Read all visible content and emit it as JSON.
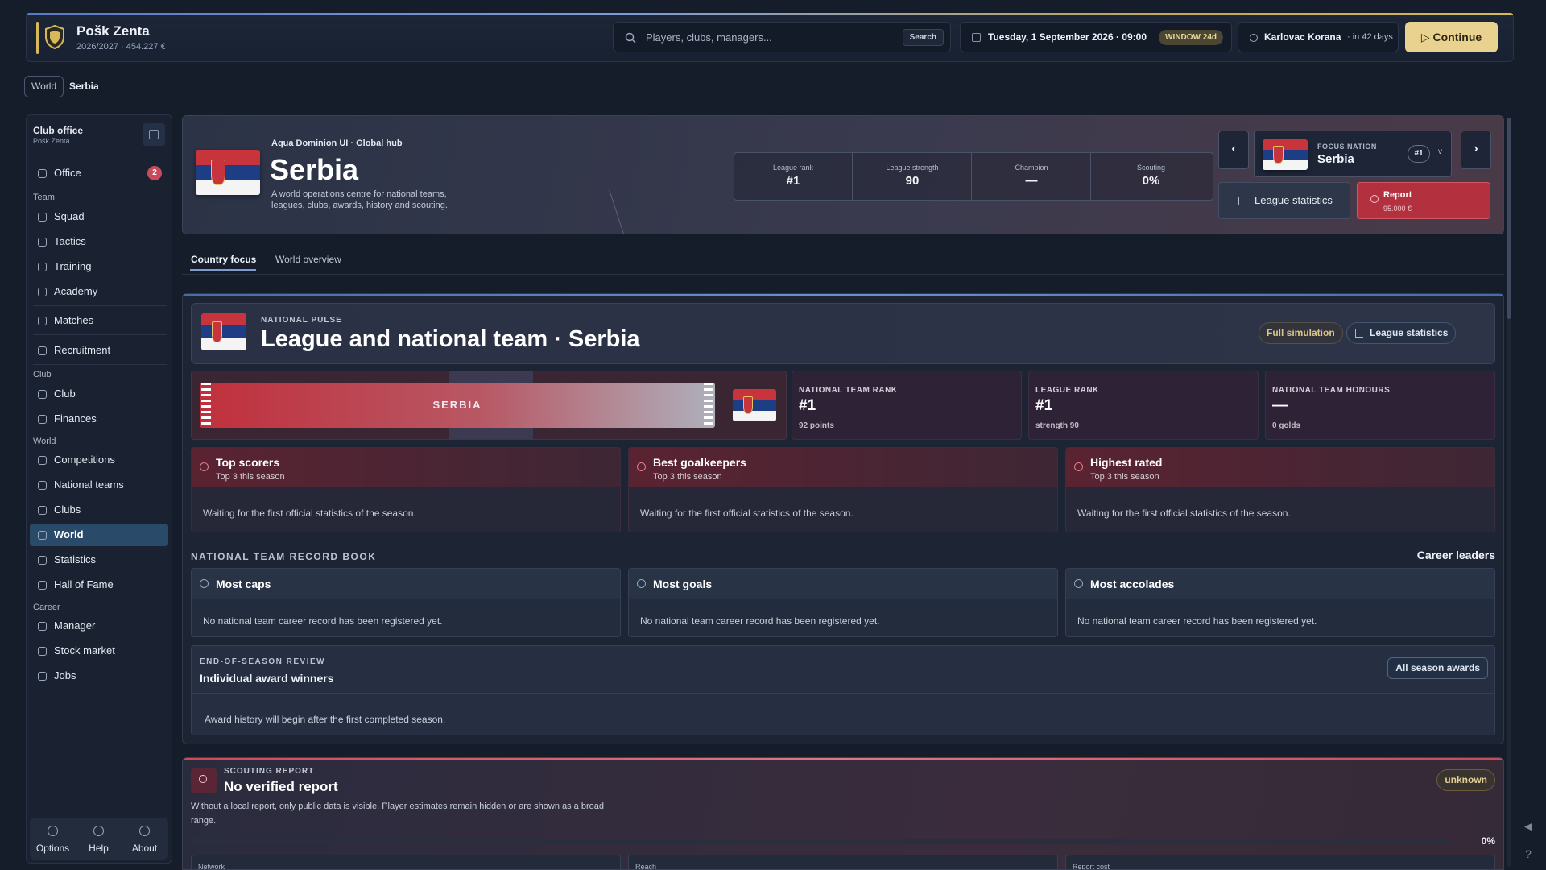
{
  "topbar": {
    "club_name": "Pošk Zenta",
    "club_sub": "2026/2027 · 454.227 €",
    "search_placeholder": "Players, clubs, managers...",
    "search_button": "Search",
    "date": "Tuesday, 1 September 2026 · 09:00",
    "window_badge": "WINDOW 24d",
    "next_opponent": "Karlovac Korana",
    "next_in": "· in 42 days",
    "continue_label": "Continue"
  },
  "breadcrumb": {
    "world": "World",
    "current": "Serbia"
  },
  "sidebar": {
    "title": "Club office",
    "subtitle": "Pošk Zenta",
    "office": {
      "label": "Office",
      "badge": "2"
    },
    "sec_team": "Team",
    "team_items": [
      "Squad",
      "Tactics",
      "Training",
      "Academy"
    ],
    "matches": "Matches",
    "recruitment": "Recruitment",
    "sec_club": "Club",
    "club_items": [
      "Club",
      "Finances"
    ],
    "sec_world": "World",
    "world_items": [
      "Competitions",
      "National teams",
      "Clubs",
      "World",
      "Statistics",
      "Hall of Fame"
    ],
    "sec_career": "Career",
    "career_items": [
      "Manager",
      "Stock market",
      "Jobs"
    ],
    "footer": [
      "Options",
      "Help",
      "About"
    ]
  },
  "hero": {
    "pre": "Aqua Dominion UI · Global hub",
    "title": "Serbia",
    "desc": "A world operations centre for national teams, leagues, clubs, awards, history and scouting.",
    "stats": [
      {
        "label": "League rank",
        "value": "#1"
      },
      {
        "label": "League strength",
        "value": "90"
      },
      {
        "label": "Champion",
        "value": "—"
      },
      {
        "label": "Scouting",
        "value": "0%"
      }
    ],
    "focus_label": "FOCUS NATION",
    "focus_name": "Serbia",
    "focus_rank": "#1",
    "league_stats_btn": "League statistics",
    "report_btn": "Report",
    "report_price": "95.000 €"
  },
  "tabs": [
    "Country focus",
    "World overview"
  ],
  "pulse": {
    "kicker": "NATIONAL PULSE",
    "title": "League and national team · Serbia",
    "full_sim": "Full simulation",
    "league_stats": "League statistics",
    "banner_text": "SERBIA",
    "kpis": [
      {
        "label": "NATIONAL TEAM RANK",
        "value": "#1",
        "sub": "92 points"
      },
      {
        "label": "LEAGUE RANK",
        "value": "#1",
        "sub": "strength 90"
      },
      {
        "label": "NATIONAL TEAM HONOURS",
        "value": "—",
        "sub": "0 golds"
      }
    ]
  },
  "season_cards": [
    {
      "title": "Top scorers",
      "sub": "Top 3 this season",
      "body": "Waiting for the first official statistics of the season."
    },
    {
      "title": "Best goalkeepers",
      "sub": "Top 3 this season",
      "body": "Waiting for the first official statistics of the season."
    },
    {
      "title": "Highest rated",
      "sub": "Top 3 this season",
      "body": "Waiting for the first official statistics of the season."
    }
  ],
  "record_book": {
    "label": "NATIONAL TEAM RECORD BOOK",
    "right": "Career leaders",
    "cards": [
      {
        "title": "Most caps",
        "body": "No national team career record has been registered yet."
      },
      {
        "title": "Most goals",
        "body": "No national team career record has been registered yet."
      },
      {
        "title": "Most accolades",
        "body": "No national team career record has been registered yet."
      }
    ]
  },
  "eos": {
    "kicker": "END-OF-SEASON REVIEW",
    "title": "Individual award winners",
    "body": "Award history will begin after the first completed season.",
    "button": "All season awards"
  },
  "scouting": {
    "kicker": "SCOUTING REPORT",
    "title": "No verified report",
    "desc": "Without a local report, only public data is visible. Player estimates remain hidden or are shown as a broad range.",
    "status": "unknown",
    "progress": "0%",
    "progress_value": 0,
    "minis": [
      "Network",
      "Reach",
      "Report cost"
    ]
  },
  "colors": {
    "accent": "#e9d190",
    "active_nav": "#2a4a6a",
    "report_red": "#b3303e",
    "serbia_red": "#c8343c",
    "serbia_blue": "#1d3d85"
  }
}
